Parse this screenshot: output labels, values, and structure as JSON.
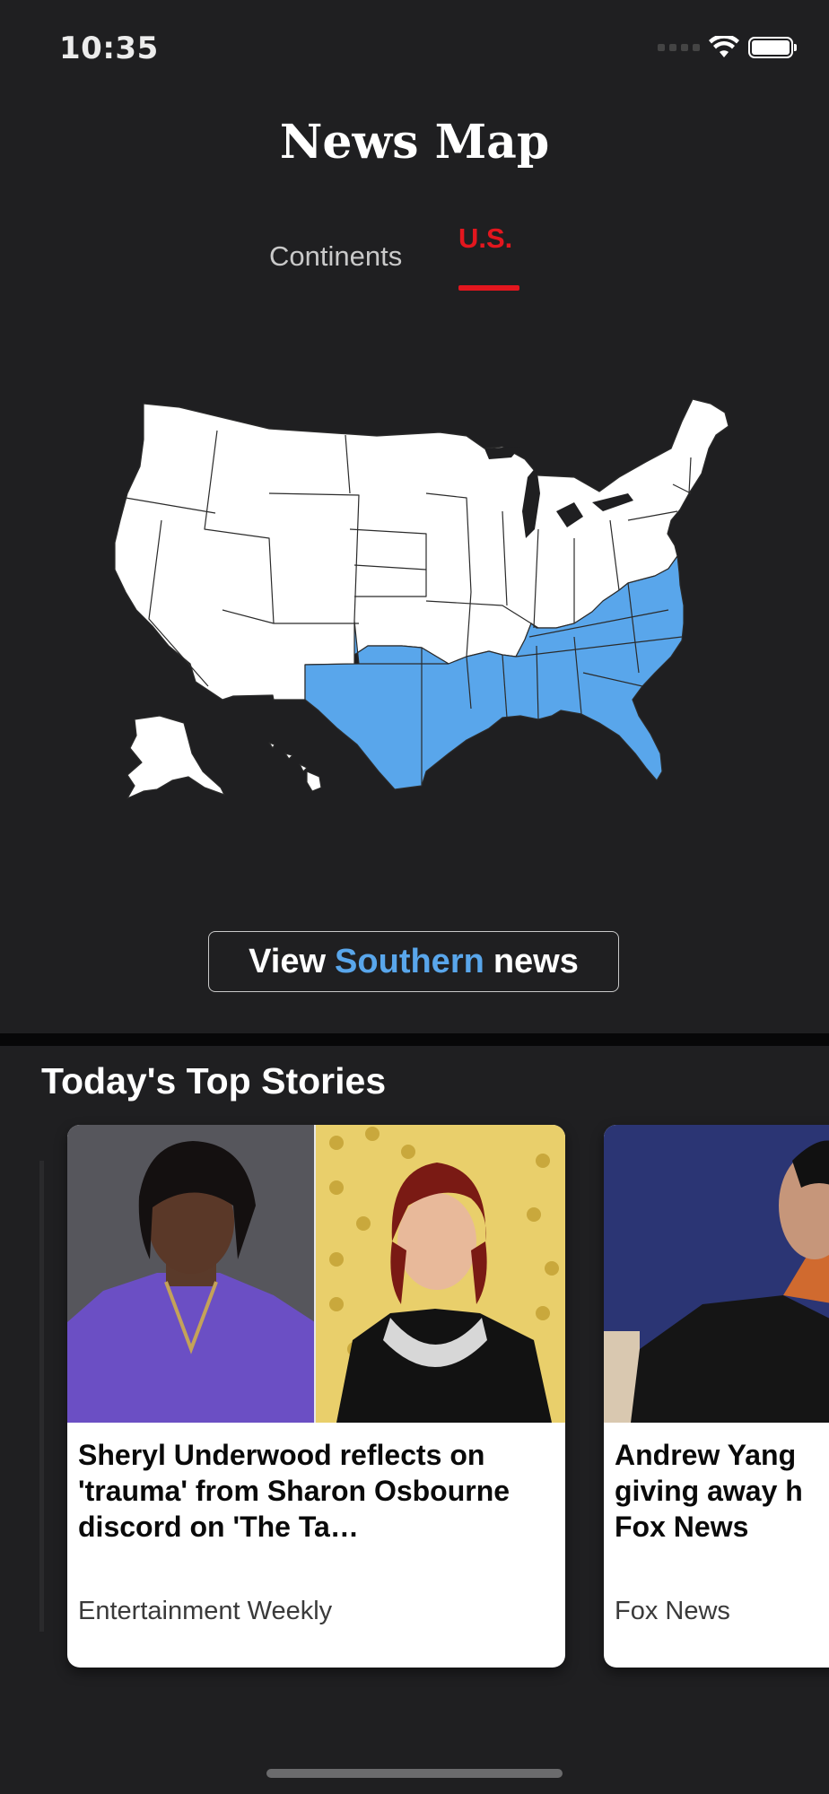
{
  "status_bar": {
    "time": "10:35"
  },
  "header": {
    "title": "News Map"
  },
  "tabs": [
    {
      "label": "Continents",
      "active": false
    },
    {
      "label": "U.S.",
      "active": true
    }
  ],
  "map": {
    "highlighted_region": "Southern",
    "highlight_color": "#59a6eb",
    "base_color": "#ffffff"
  },
  "cta": {
    "prefix": "View",
    "region": "Southern",
    "suffix": "news"
  },
  "section": {
    "title": "Today's Top Stories"
  },
  "stories": [
    {
      "headline": "Sheryl Underwood reflects on 'trauma' from Sharon Osbourne discord on 'The Ta…",
      "source": "Entertainment Weekly"
    },
    {
      "headline": "Andrew Yang giving away h Fox News",
      "source": "Fox News"
    }
  ],
  "colors": {
    "accent_red": "#e3161e",
    "accent_blue": "#59a6eb",
    "background": "#1f1f21"
  }
}
